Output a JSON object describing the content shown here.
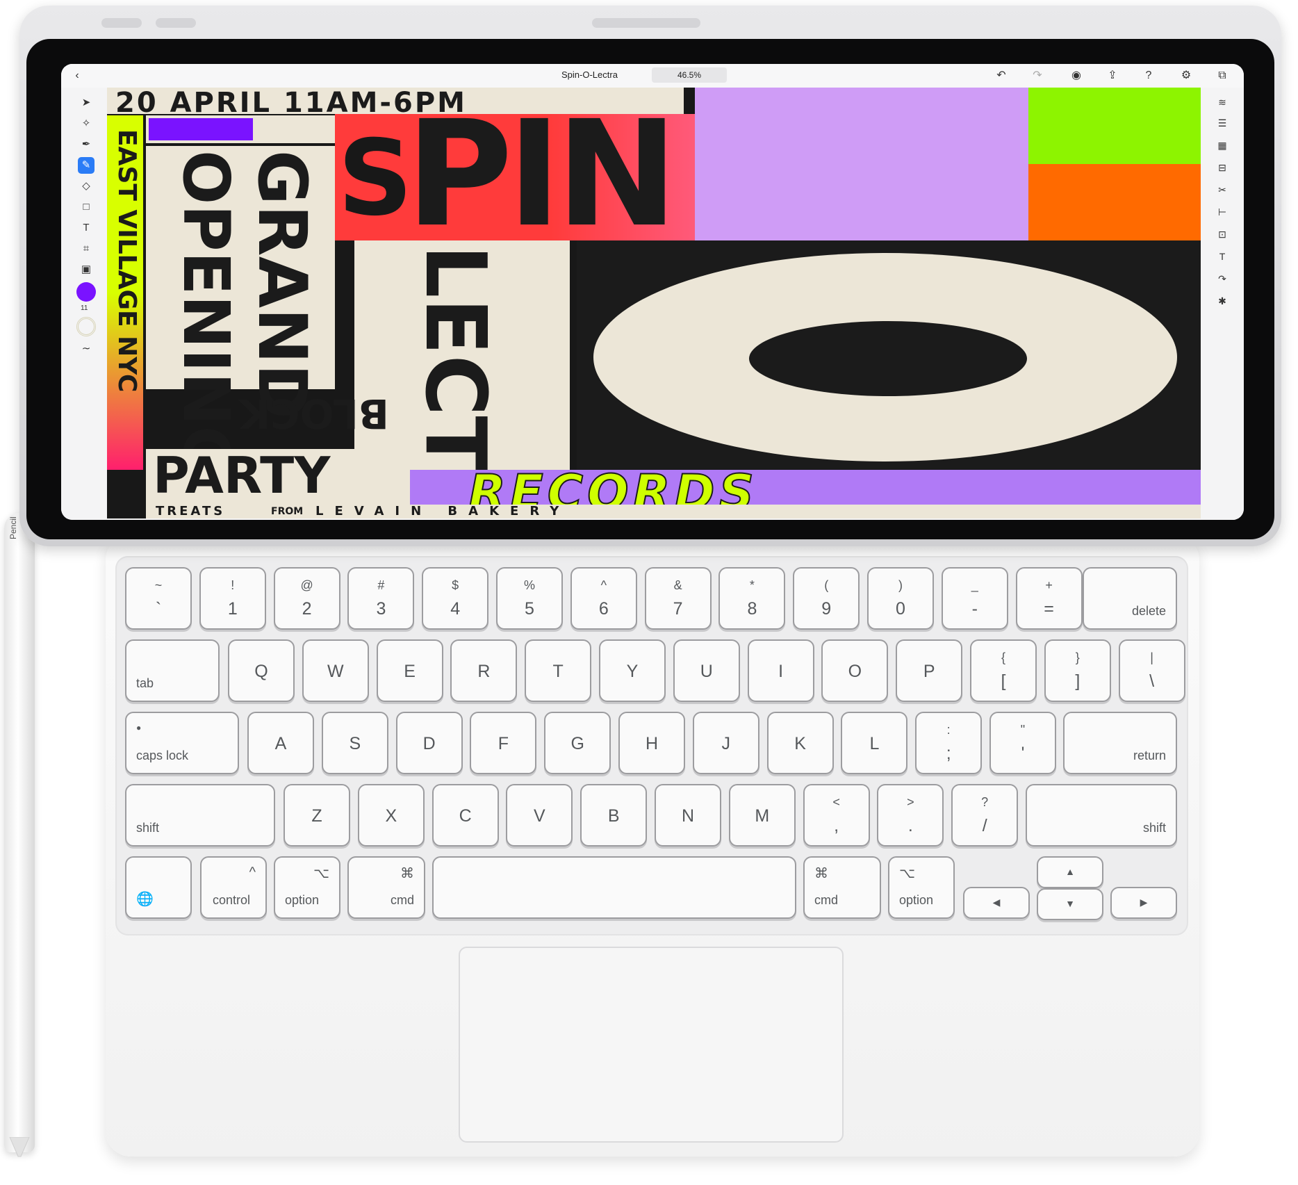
{
  "app": {
    "document_title": "Spin-O-Lectra",
    "zoom": "46.5%",
    "left_tools": [
      "pointer-icon",
      "subselect-icon",
      "pen-icon",
      "pencil-icon",
      "eraser-icon",
      "shape-icon",
      "type-icon",
      "crop-icon",
      "image-icon",
      "color-swatch",
      "stroke-swatch",
      "curve-icon"
    ],
    "right_tools": [
      "layers-icon",
      "adjust-icon",
      "grid-icon",
      "align-icon",
      "scissors-icon",
      "distribute-icon",
      "transform-icon",
      "text-style-icon",
      "path-icon",
      "settings-icon"
    ],
    "toolbar_icons": [
      "undo-icon",
      "redo-icon",
      "account-icon",
      "share-icon",
      "help-icon",
      "gear-icon",
      "export-icon"
    ],
    "swatch_color": "#7a13ff",
    "stroke_value": "11"
  },
  "artwork": {
    "line1": "20 APRIL 11AM-6PM",
    "spin_s": "S",
    "spin": "PIN",
    "side_text": "EAST VILLAGE NYC",
    "grand": "GRAND",
    "opening": "OPENING",
    "block": "BLOCK",
    "party": "PARTY",
    "lectra": "LECTRA",
    "o": "O",
    "records": "RECORDS",
    "treats": "TREATS",
    "from": "FROM",
    "bakery": "LEVAIN BAKERY"
  },
  "keyboard": {
    "row1": [
      {
        "top": "~",
        "bot": "`"
      },
      {
        "top": "!",
        "bot": "1"
      },
      {
        "top": "@",
        "bot": "2"
      },
      {
        "top": "#",
        "bot": "3"
      },
      {
        "top": "$",
        "bot": "4"
      },
      {
        "top": "%",
        "bot": "5"
      },
      {
        "top": "^",
        "bot": "6"
      },
      {
        "top": "&",
        "bot": "7"
      },
      {
        "top": "*",
        "bot": "8"
      },
      {
        "top": "(",
        "bot": "9"
      },
      {
        "top": ")",
        "bot": "0"
      },
      {
        "top": "_",
        "bot": "-"
      },
      {
        "top": "+",
        "bot": "="
      }
    ],
    "delete": "delete",
    "tab": "tab",
    "row2": [
      "Q",
      "W",
      "E",
      "R",
      "T",
      "Y",
      "U",
      "I",
      "O",
      "P"
    ],
    "row2_sym": [
      {
        "top": "{",
        "bot": "["
      },
      {
        "top": "}",
        "bot": "]"
      },
      {
        "top": "|",
        "bot": "\\"
      }
    ],
    "caps": "caps lock",
    "row3": [
      "A",
      "S",
      "D",
      "F",
      "G",
      "H",
      "J",
      "K",
      "L"
    ],
    "row3_sym": [
      {
        "top": ":",
        "bot": ";"
      },
      {
        "top": "\"",
        "bot": "'"
      }
    ],
    "return": "return",
    "shift_left": "shift",
    "row4": [
      "Z",
      "X",
      "C",
      "V",
      "B",
      "N",
      "M"
    ],
    "row4_sym": [
      {
        "top": "<",
        "bot": ","
      },
      {
        "top": ">",
        "bot": "."
      },
      {
        "top": "?",
        "bot": "/"
      }
    ],
    "shift_right": "shift",
    "globe": "🌐",
    "control": "control",
    "control_sym": "^",
    "option": "option",
    "option_sym": "⌥",
    "cmd": "cmd",
    "cmd_sym": "⌘",
    "arrow_up": "▲",
    "arrow_down": "▼",
    "arrow_left": "◀",
    "arrow_right": "▶"
  },
  "pencil": {
    "label": " Pencil"
  }
}
